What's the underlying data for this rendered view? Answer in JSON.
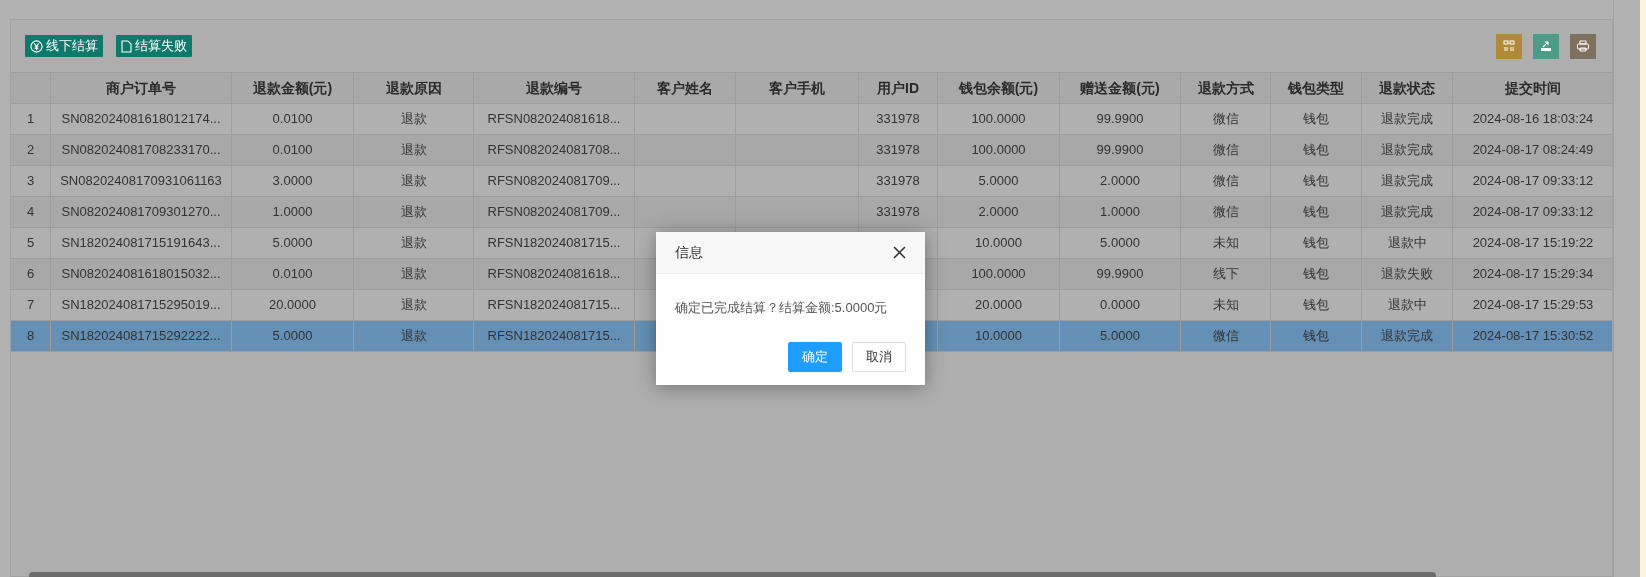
{
  "toolbar": {
    "buttons": [
      {
        "label": "线下结算",
        "kind": "yen"
      },
      {
        "label": "结算失败",
        "kind": "file"
      }
    ],
    "tools": [
      {
        "kind": "columns"
      },
      {
        "kind": "export"
      },
      {
        "kind": "print"
      }
    ]
  },
  "table": {
    "columns": [
      "",
      "商户订单号",
      "退款金额(元)",
      "退款原因",
      "退款编号",
      "客户姓名",
      "客户手机",
      "用户ID",
      "钱包余额(元)",
      "赠送金额(元)",
      "退款方式",
      "钱包类型",
      "退款状态",
      "提交时间"
    ],
    "rows": [
      {
        "index": "1",
        "merchant_order_no": "SN082024081618012174...",
        "refund_amount": "0.0100",
        "refund_reason": "退款",
        "refund_no": "RFSN082024081618...",
        "user_id": "331978",
        "wallet_balance": "100.0000",
        "bonus_amount": "99.9900",
        "refund_method": "微信",
        "wallet_type": "钱包",
        "refund_status": "退款完成",
        "submitted_at": "2024-08-16 18:03:24",
        "selected": false
      },
      {
        "index": "2",
        "merchant_order_no": "SN082024081708233170...",
        "refund_amount": "0.0100",
        "refund_reason": "退款",
        "refund_no": "RFSN082024081708...",
        "user_id": "331978",
        "wallet_balance": "100.0000",
        "bonus_amount": "99.9900",
        "refund_method": "微信",
        "wallet_type": "钱包",
        "refund_status": "退款完成",
        "submitted_at": "2024-08-17 08:24:49",
        "selected": false
      },
      {
        "index": "3",
        "merchant_order_no": "SN08202408170931061163",
        "refund_amount": "3.0000",
        "refund_reason": "退款",
        "refund_no": "RFSN082024081709...",
        "user_id": "331978",
        "wallet_balance": "5.0000",
        "bonus_amount": "2.0000",
        "refund_method": "微信",
        "wallet_type": "钱包",
        "refund_status": "退款完成",
        "submitted_at": "2024-08-17 09:33:12",
        "selected": false
      },
      {
        "index": "4",
        "merchant_order_no": "SN082024081709301270...",
        "refund_amount": "1.0000",
        "refund_reason": "退款",
        "refund_no": "RFSN082024081709...",
        "user_id": "331978",
        "wallet_balance": "2.0000",
        "bonus_amount": "1.0000",
        "refund_method": "微信",
        "wallet_type": "钱包",
        "refund_status": "退款完成",
        "submitted_at": "2024-08-17 09:33:12",
        "selected": false
      },
      {
        "index": "5",
        "merchant_order_no": "SN182024081715191643...",
        "refund_amount": "5.0000",
        "refund_reason": "退款",
        "refund_no": "RFSN182024081715...",
        "wallet_balance": "10.0000",
        "bonus_amount": "5.0000",
        "refund_method": "未知",
        "wallet_type": "钱包",
        "refund_status": "退款中",
        "submitted_at": "2024-08-17 15:19:22",
        "selected": false
      },
      {
        "index": "6",
        "merchant_order_no": "SN082024081618015032...",
        "refund_amount": "0.0100",
        "refund_reason": "退款",
        "refund_no": "RFSN082024081618...",
        "wallet_balance": "100.0000",
        "bonus_amount": "99.9900",
        "refund_method": "线下",
        "wallet_type": "钱包",
        "refund_status": "退款失败",
        "submitted_at": "2024-08-17 15:29:34",
        "selected": false
      },
      {
        "index": "7",
        "merchant_order_no": "SN182024081715295019...",
        "refund_amount": "20.0000",
        "refund_reason": "退款",
        "refund_no": "RFSN182024081715...",
        "wallet_balance": "20.0000",
        "bonus_amount": "0.0000",
        "refund_method": "未知",
        "wallet_type": "钱包",
        "refund_status": "退款中",
        "submitted_at": "2024-08-17 15:29:53",
        "selected": false
      },
      {
        "index": "8",
        "merchant_order_no": "SN182024081715292222...",
        "refund_amount": "5.0000",
        "refund_reason": "退款",
        "refund_no": "RFSN182024081715...",
        "wallet_balance": "10.0000",
        "bonus_amount": "5.0000",
        "refund_method": "微信",
        "wallet_type": "钱包",
        "refund_status": "退款完成",
        "submitted_at": "2024-08-17 15:30:52",
        "selected": true
      }
    ]
  },
  "dialog": {
    "title": "信息",
    "message": "确定已完成结算？结算金额:5.0000元",
    "buttons": [
      {
        "label": "确定",
        "kind": "primary"
      },
      {
        "label": "取消",
        "kind": "secondary"
      }
    ]
  }
}
